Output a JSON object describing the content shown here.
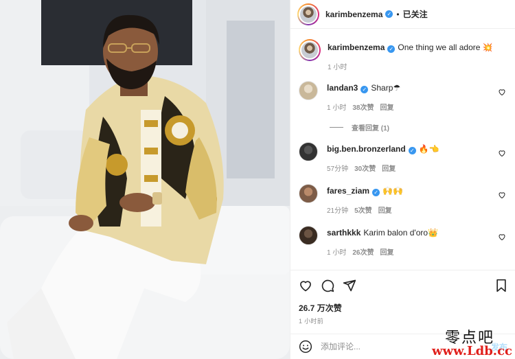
{
  "post": {
    "author": "karimbenzema",
    "follow_status": "已关注",
    "separator": "•",
    "caption": "One thing we all adore",
    "caption_emoji": "💥",
    "caption_time": "1 小时"
  },
  "comments": [
    {
      "user": "landan3",
      "verified": true,
      "text": "Sharp☂",
      "time": "1 小时",
      "likes": "38次赞",
      "reply": "回复"
    },
    {
      "user": "big.ben.bronzerland",
      "verified": true,
      "text": "🔥👈",
      "time": "57分钟",
      "likes": "30次赞",
      "reply": "回复"
    },
    {
      "user": "fares_ziam",
      "verified": true,
      "text": "🙌🙌",
      "time": "21分钟",
      "likes": "5次赞",
      "reply": "回复"
    },
    {
      "user": "sarthkkk",
      "verified": false,
      "text": "Karim balon d'oro👑",
      "time": "1 小时",
      "likes": "26次赞",
      "reply": "回复"
    }
  ],
  "view_replies": "查看回复 (1)",
  "stats": {
    "likes": "26.7 万次赞",
    "time_ago": "1 小时前"
  },
  "composer": {
    "placeholder": "添加评论...",
    "post_label": "发布"
  },
  "watermark": {
    "line1": "零点吧",
    "line2": "www.Ldb.cc"
  },
  "icons": {
    "like": "heart-icon",
    "comment": "comment-icon",
    "share": "share-icon",
    "save": "bookmark-icon",
    "emoji": "smiley-icon"
  },
  "colors": {
    "verified": "#3897f0",
    "muted": "#8e8e8e",
    "post_btn": "#b2dffc"
  }
}
